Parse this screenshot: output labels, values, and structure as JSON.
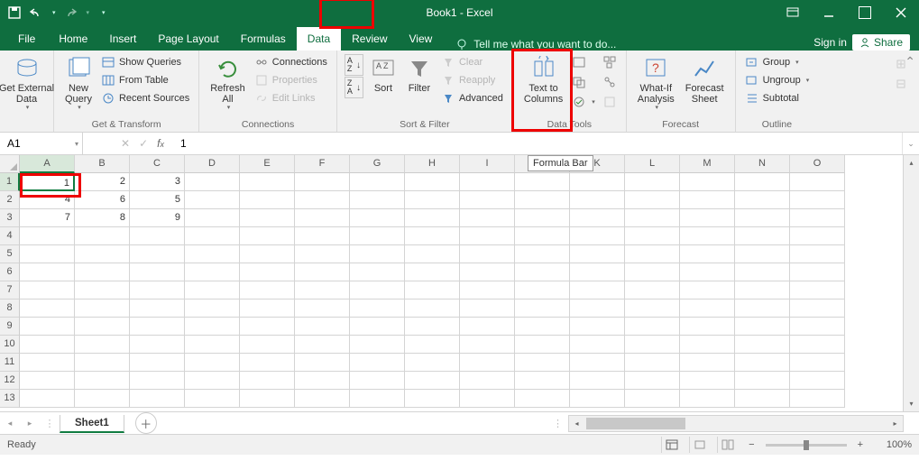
{
  "window": {
    "title": "Book1 - Excel"
  },
  "tabs": {
    "file": "File",
    "items": [
      "Home",
      "Insert",
      "Page Layout",
      "Formulas",
      "Data",
      "Review",
      "View"
    ],
    "active": "Data",
    "tell_me": "Tell me what you want to do...",
    "sign_in": "Sign in",
    "share": "Share"
  },
  "ribbon": {
    "get_transform": {
      "label": "Get & Transform",
      "get_external": "Get External\nData",
      "new_query": "New\nQuery",
      "show_queries": "Show Queries",
      "from_table": "From Table",
      "recent_sources": "Recent Sources"
    },
    "connections": {
      "label": "Connections",
      "refresh": "Refresh\nAll",
      "conns": "Connections",
      "props": "Properties",
      "edit_links": "Edit Links"
    },
    "sort_filter": {
      "label": "Sort & Filter",
      "sort": "Sort",
      "filter": "Filter",
      "clear": "Clear",
      "reapply": "Reapply",
      "advanced": "Advanced"
    },
    "data_tools": {
      "label": "Data Tools",
      "text_to_columns": "Text to\nColumns"
    },
    "forecast": {
      "label": "Forecast",
      "what_if": "What-If\nAnalysis",
      "forecast_sheet": "Forecast\nSheet"
    },
    "outline": {
      "label": "Outline",
      "group": "Group",
      "ungroup": "Ungroup",
      "subtotal": "Subtotal"
    }
  },
  "namebox": {
    "cell": "A1"
  },
  "formula": {
    "value": "1"
  },
  "tooltip": {
    "formula_bar": "Formula Bar"
  },
  "grid": {
    "cols": [
      "A",
      "B",
      "C",
      "D",
      "E",
      "F",
      "G",
      "H",
      "I",
      "J",
      "K",
      "L",
      "M",
      "N",
      "O"
    ],
    "rows": [
      1,
      2,
      3,
      4,
      5,
      6,
      7,
      8,
      9,
      10,
      11,
      12,
      13
    ],
    "data": [
      [
        "1",
        "2",
        "3"
      ],
      [
        "4",
        "6",
        "5"
      ],
      [
        "7",
        "8",
        "9"
      ]
    ],
    "active": "A1"
  },
  "sheets": {
    "active": "Sheet1"
  },
  "status": {
    "ready": "Ready",
    "zoom": "100%"
  },
  "chart_data": {
    "type": "table",
    "columns": [
      "A",
      "B",
      "C"
    ],
    "rows": [
      [
        1,
        2,
        3
      ],
      [
        4,
        6,
        5
      ],
      [
        7,
        8,
        9
      ]
    ]
  }
}
